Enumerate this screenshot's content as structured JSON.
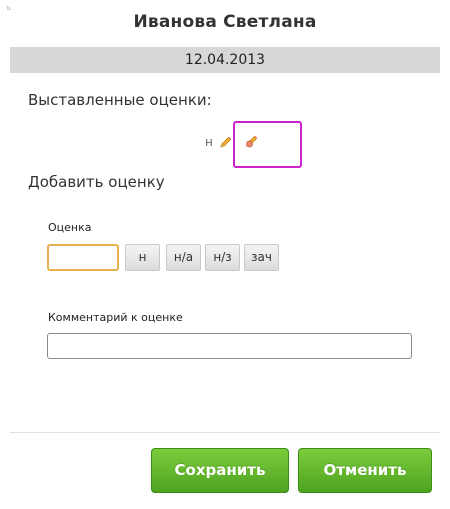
{
  "header": {
    "corner_mark": "ъ",
    "student_name": "Иванова Светлана",
    "date": "12.04.2013"
  },
  "grades_section": {
    "heading": "Выставленные оценки:",
    "existing_grades": [
      {
        "value": "н"
      }
    ]
  },
  "add_section": {
    "heading": "Добавить оценку",
    "grade_label": "Оценка",
    "grade_value": "",
    "grade_buttons": [
      {
        "label": "н"
      },
      {
        "label": "н/а"
      },
      {
        "label": "н/з"
      },
      {
        "label": "зач"
      }
    ],
    "comment_label": "Комментарий к оценке",
    "comment_value": ""
  },
  "footer": {
    "save_label": "Сохранить",
    "cancel_label": "Отменить"
  },
  "colors": {
    "highlight_border": "#cc22cc",
    "focused_input_border": "#e7b24c",
    "button_green_top": "#7ccc3b",
    "button_green_bottom": "#4ea421",
    "date_bar_bg": "#d7d7d7"
  },
  "icons": {
    "edit": "pencil-icon",
    "selected_edit": "pencil-eraser-icon"
  }
}
